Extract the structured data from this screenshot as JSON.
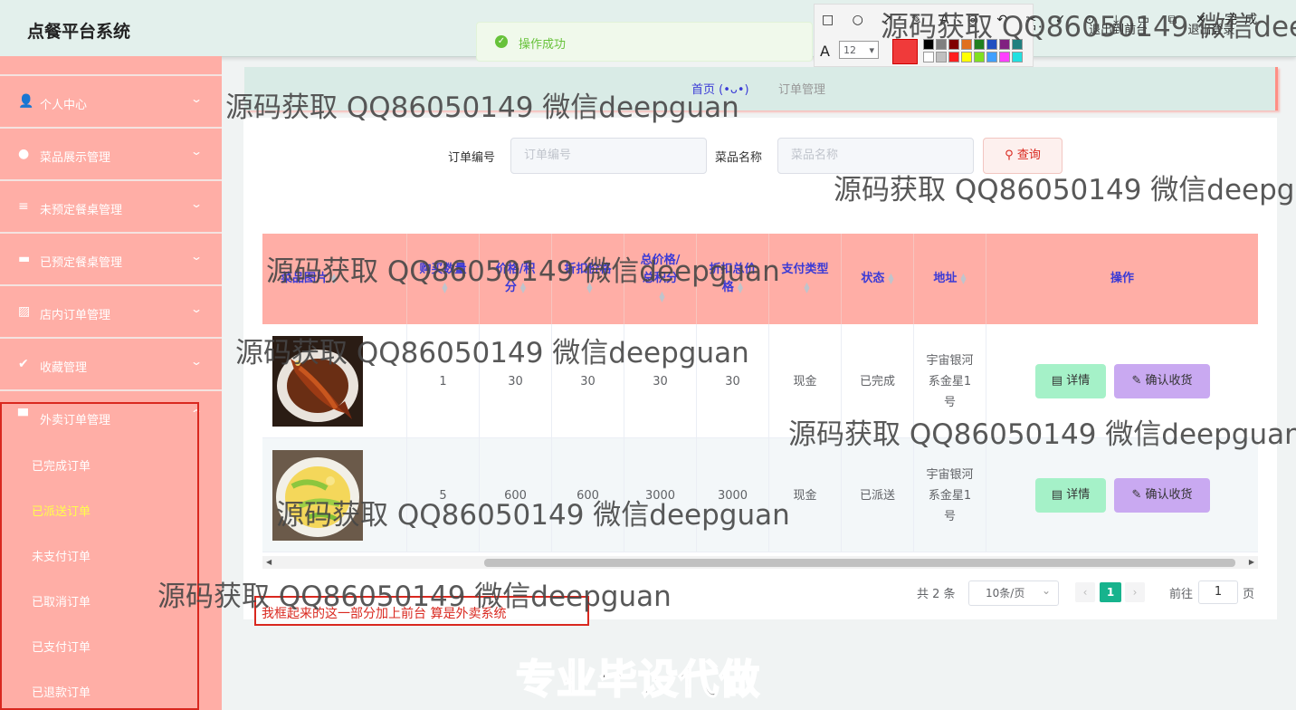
{
  "app": {
    "title": "点餐平台系统"
  },
  "toast": {
    "message": "操作成功"
  },
  "header_right": [
    "用户：",
    "退出到前台",
    "退出登录"
  ],
  "annot_toolbar": {
    "tools": "□ ○ ↗ ✎ A ◎ ↶ ✂ ✓ ⊙ ⤓ ▭ ⧉ ✕ 完成",
    "font_glyph": "A",
    "font_size": "12",
    "current_color": "#f03a3a",
    "palette": [
      "#000000",
      "#808080",
      "#800000",
      "#e07020",
      "#208020",
      "#2050c0",
      "#802080",
      "#208080",
      "#ffffff",
      "#c0c0c0",
      "#ff2020",
      "#ffff00",
      "#80e020",
      "#40a0ff",
      "#ff40ff",
      "#20e0e0"
    ]
  },
  "sidebar": {
    "items": [
      {
        "icon": "👤",
        "label": "个人中心"
      },
      {
        "icon": "●",
        "label": "菜品展示管理"
      },
      {
        "icon": "≡",
        "label": "未预定餐桌管理"
      },
      {
        "icon": "▬",
        "label": "已预定餐桌管理"
      },
      {
        "icon": "▨",
        "label": "店内订单管理"
      },
      {
        "icon": "✔",
        "label": "收藏管理"
      },
      {
        "icon": "▀",
        "label": "外卖订单管理"
      }
    ],
    "submenu": [
      {
        "label": "已完成订单",
        "active": false
      },
      {
        "label": "已派送订单",
        "active": true
      },
      {
        "label": "未支付订单",
        "active": false
      },
      {
        "label": "已取消订单",
        "active": false
      },
      {
        "label": "已支付订单",
        "active": false
      },
      {
        "label": "已退款订单",
        "active": false
      }
    ]
  },
  "breadcrumb": {
    "home": "首页 (•ᴗ•)",
    "current": "订单管理"
  },
  "search": {
    "order_no_label": "订单编号",
    "order_no_placeholder": "订单编号",
    "dish_label": "菜品名称",
    "dish_placeholder": "菜品名称",
    "query_label": "查询"
  },
  "table": {
    "headers": [
      "菜品图片",
      "购买数量",
      "价格/积分",
      "折扣价格",
      "总价格/总积分",
      "折扣总价格",
      "支付类型",
      "状态",
      "地址",
      "操作"
    ],
    "rows": [
      {
        "qty": "1",
        "price": "30",
        "discount": "30",
        "total": "30",
        "discount_total": "30",
        "pay_type": "现金",
        "status": "已完成",
        "address": "宇宙银河系金星1号",
        "detail": "详情",
        "confirm": "确认收货"
      },
      {
        "qty": "5",
        "price": "600",
        "discount": "600",
        "total": "3000",
        "discount_total": "3000",
        "pay_type": "现金",
        "status": "已派送",
        "address": "宇宙银河系金星1号",
        "detail": "详情",
        "confirm": "确认收货"
      }
    ]
  },
  "pagination": {
    "total": "共 2 条",
    "page_size": "10条/页",
    "current_page": "1",
    "goto_prefix": "前往",
    "goto_value": "1",
    "goto_suffix": "页"
  },
  "annotation_note": "我框起来的这一部分加上前台 算是外卖系统",
  "slogan": "专业毕设代做",
  "watermark": "源码获取 QQ86050149 微信deepguan"
}
